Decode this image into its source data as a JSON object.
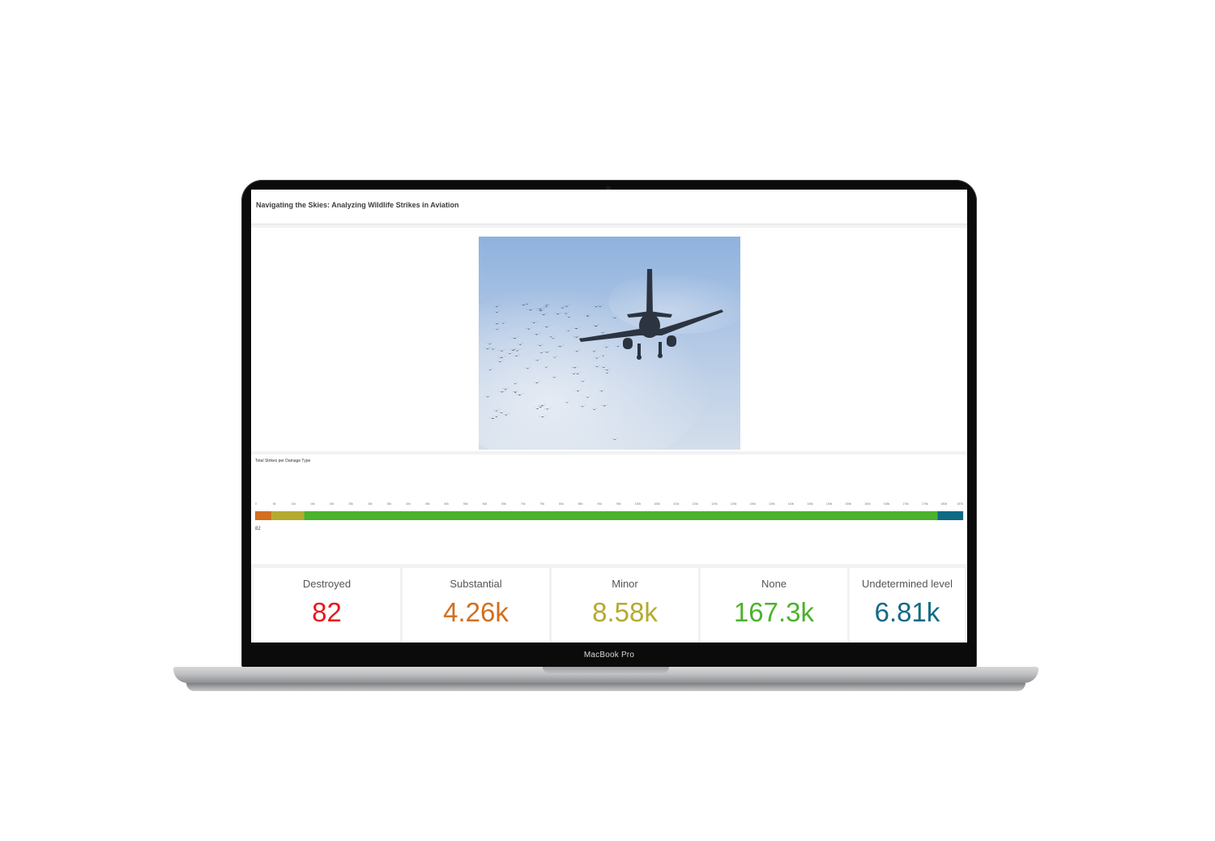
{
  "device": {
    "label": "MacBook Pro"
  },
  "dashboard": {
    "title": "Navigating the Skies: Analyzing Wildlife Strikes in Aviation",
    "hero_image": {
      "subject": "airplane-with-bird-flock"
    }
  },
  "chart_data": {
    "type": "bar",
    "orientation": "horizontal-stacked",
    "title": "Total Strikes per Damage Type",
    "categories": [
      "Destroyed",
      "Substantial",
      "Minor",
      "None",
      "Undetermined level"
    ],
    "values": [
      82,
      4260,
      8580,
      167300,
      6810
    ],
    "colors": [
      "#e8171d",
      "#d36f1e",
      "#b5aa2f",
      "#4bb22c",
      "#0f6a86"
    ],
    "xlim": [
      0,
      187000
    ],
    "tick_labels": [
      "0",
      "5k",
      "10k",
      "15k",
      "20k",
      "25k",
      "30k",
      "35k",
      "40k",
      "45k",
      "50k",
      "55k",
      "60k",
      "65k",
      "70k",
      "75k",
      "80k",
      "85k",
      "90k",
      "95k",
      "100k",
      "105k",
      "110k",
      "115k",
      "120k",
      "125k",
      "130k",
      "135k",
      "140k",
      "145k",
      "150k",
      "155k",
      "160k",
      "165k",
      "170k",
      "175k",
      "180k",
      "187k"
    ],
    "data_labels": [
      "82"
    ],
    "grid": false,
    "legend": "none"
  },
  "kpis": [
    {
      "label": "Destroyed",
      "value": "82",
      "color": "#e8171d"
    },
    {
      "label": "Substantial",
      "value": "4.26k",
      "color": "#d36f1e"
    },
    {
      "label": "Minor",
      "value": "8.58k",
      "color": "#b5aa2f"
    },
    {
      "label": "None",
      "value": "167.3k",
      "color": "#4bb22c"
    },
    {
      "label": "Undetermined level",
      "value": "6.81k",
      "color": "#0f6a86"
    }
  ]
}
